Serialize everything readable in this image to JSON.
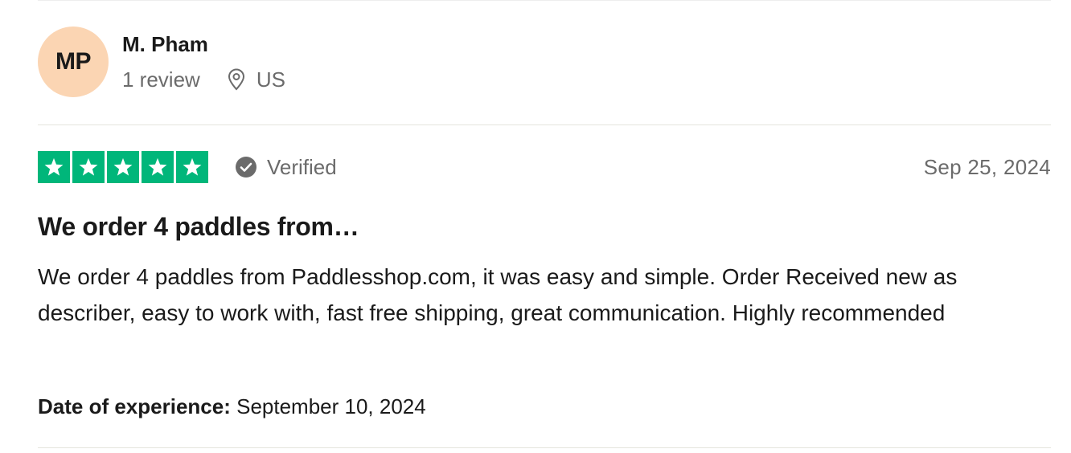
{
  "consumer": {
    "initials": "MP",
    "name": "M. Pham",
    "review_count": "1 review",
    "location": "US",
    "avatar_color": "#fbd5b3"
  },
  "rating": {
    "stars": 5,
    "max_stars": 5,
    "star_color": "#00b67a",
    "verified_label": "Verified",
    "date": "Sep 25, 2024"
  },
  "review": {
    "title": "We order 4 paddles from…",
    "body": "We order 4 paddles from Paddlesshop.com, it was easy and simple. Order Received new as describer, easy to work with, fast free shipping, great communication. Highly recommended"
  },
  "experience": {
    "label": "Date of experience:",
    "value": "September 10, 2024"
  },
  "icons": {
    "location": "map-pin-icon",
    "verified": "check-circle-icon",
    "star": "star-icon"
  }
}
